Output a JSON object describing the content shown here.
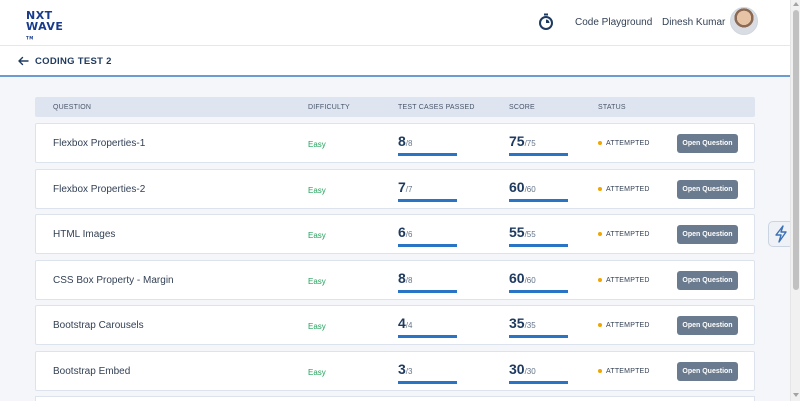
{
  "header": {
    "logo_line1": "NXT",
    "logo_line2": "WAVE",
    "logo_tm": "TM",
    "nav_link": "Code Playground",
    "user_name": "Dinesh Kumar"
  },
  "subheader": {
    "title": "CODING TEST 2"
  },
  "table": {
    "columns": [
      "QUESTION",
      "DIFFICULTY",
      "TEST CASES PASSED",
      "SCORE",
      "STATUS"
    ],
    "rows": [
      {
        "question": "Flexbox Properties-1",
        "difficulty": "Easy",
        "passed": "8",
        "passed_total": "/8",
        "passed_ratio": 1.0,
        "score": "75",
        "score_total": "/75",
        "score_ratio": 1.0,
        "status": "ATTEMPTED",
        "action": "Open Question"
      },
      {
        "question": "Flexbox Properties-2",
        "difficulty": "Easy",
        "passed": "7",
        "passed_total": "/7",
        "passed_ratio": 1.0,
        "score": "60",
        "score_total": "/60",
        "score_ratio": 1.0,
        "status": "ATTEMPTED",
        "action": "Open Question"
      },
      {
        "question": "HTML Images",
        "difficulty": "Easy",
        "passed": "6",
        "passed_total": "/6",
        "passed_ratio": 1.0,
        "score": "55",
        "score_total": "/55",
        "score_ratio": 1.0,
        "status": "ATTEMPTED",
        "action": "Open Question"
      },
      {
        "question": "CSS Box Property - Margin",
        "difficulty": "Easy",
        "passed": "8",
        "passed_total": "/8",
        "passed_ratio": 1.0,
        "score": "60",
        "score_total": "/60",
        "score_ratio": 1.0,
        "status": "ATTEMPTED",
        "action": "Open Question"
      },
      {
        "question": "Bootstrap Carousels",
        "difficulty": "Easy",
        "passed": "4",
        "passed_total": "/4",
        "passed_ratio": 1.0,
        "score": "35",
        "score_total": "/35",
        "score_ratio": 1.0,
        "status": "ATTEMPTED",
        "action": "Open Question"
      },
      {
        "question": "Bootstrap Embed",
        "difficulty": "Easy",
        "passed": "3",
        "passed_total": "/3",
        "passed_ratio": 1.0,
        "score": "30",
        "score_total": "/30",
        "score_ratio": 1.0,
        "status": "ATTEMPTED",
        "action": "Open Question"
      }
    ]
  },
  "colors": {
    "brand": "#183b8c",
    "easy": "#23a15b",
    "progress": "#2a74c6",
    "status_dot": "#f0a500",
    "button": "#6b7b8f"
  },
  "icons": {
    "timer": "stopwatch-icon",
    "back": "arrow-left-icon",
    "widget": "lightning-icon"
  }
}
